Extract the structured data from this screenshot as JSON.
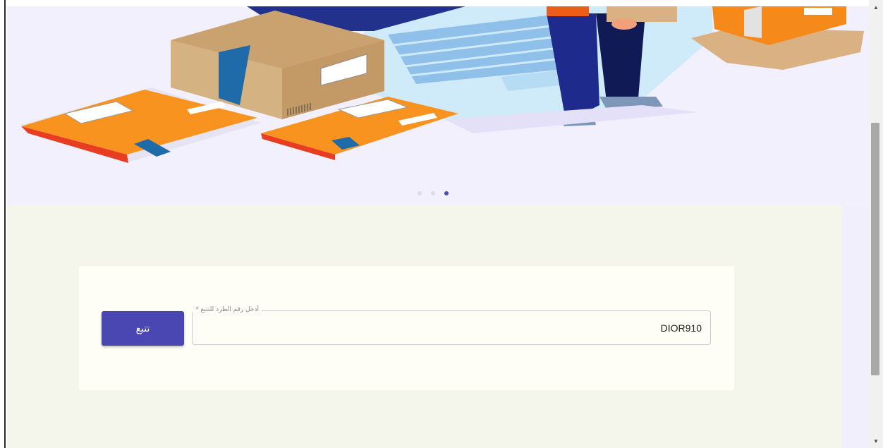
{
  "hero": {
    "carousel": {
      "slide_count": 3,
      "active_index": 2
    }
  },
  "tracking_form": {
    "button_label": "تتبع",
    "field_label": "أدخل رقم الطرد للتتبع *",
    "field_value": "DIOR910"
  },
  "scrollbar": {
    "up_glyph": "▲",
    "down_glyph": "▼"
  },
  "colors": {
    "accent": "#4a47b3",
    "hero_bg": "#f2f0fd",
    "content_bg": "#f4f6ec",
    "card_bg": "#fefef6"
  }
}
